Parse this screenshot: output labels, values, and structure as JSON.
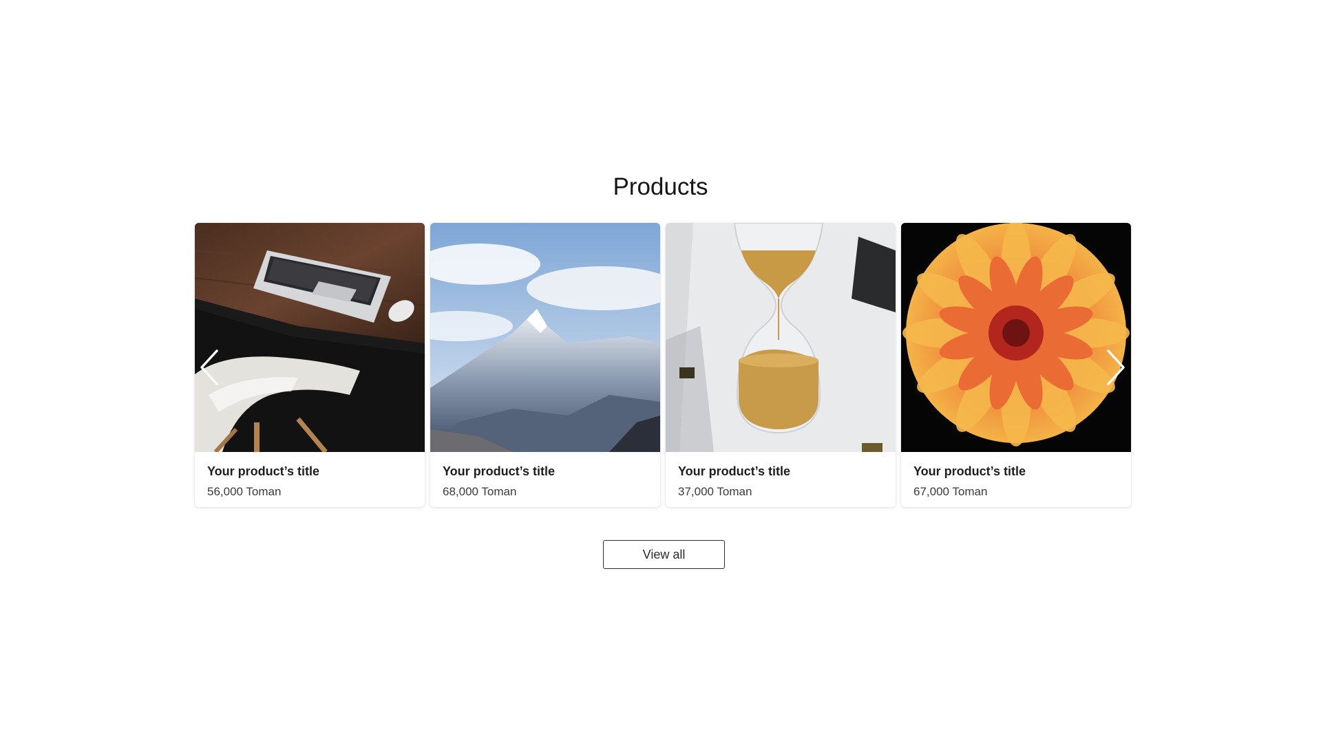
{
  "section": {
    "title": "Products"
  },
  "products": [
    {
      "title": "Your product’s title",
      "price": "56,000 Toman",
      "image": "laptop-desk-chair-photo"
    },
    {
      "title": "Your product’s title",
      "price": "68,000 Toman",
      "image": "snowy-mountain-photo"
    },
    {
      "title": "Your product’s title",
      "price": "37,000 Toman",
      "image": "hourglass-photo"
    },
    {
      "title": "Your product’s title",
      "price": "67,000 Toman",
      "image": "orange-dahlia-flower-photo"
    }
  ],
  "carousel": {
    "prev_icon": "chevron-left-icon",
    "next_icon": "chevron-right-icon"
  },
  "actions": {
    "view_all_label": "View all"
  }
}
